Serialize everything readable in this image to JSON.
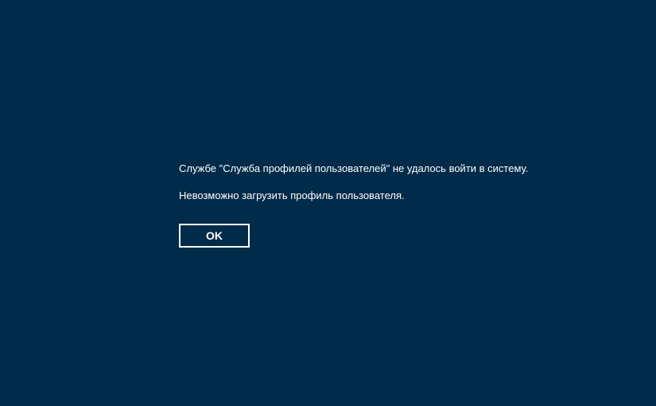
{
  "error": {
    "line1": "Службе \"Служба профилей пользователей\" не удалось войти в систему.",
    "line2": "Невозможно загрузить профиль пользователя."
  },
  "button": {
    "ok_label": "OK"
  },
  "colors": {
    "background": "#002b4a",
    "text": "#ffffff",
    "button_border": "#ffffff"
  }
}
